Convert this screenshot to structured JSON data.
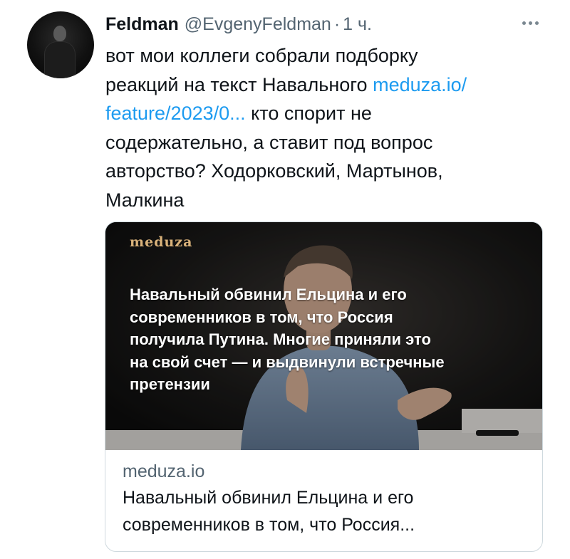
{
  "tweet": {
    "display_name": "Feldman",
    "handle": "@EvgenyFeldman",
    "separator": "·",
    "time": "1 ч.",
    "more_icon": "more-horizontal-icon",
    "text": {
      "line1": "вот мои коллеги собрали подборку",
      "line2_text": "реакций на текст Навального ",
      "line2_link": "meduza.io/",
      "line3_link": "feature/2023/0...",
      "line3_text": " кто спорит не",
      "line4": "содержательно, а ставит под вопрос",
      "line5": "авторство? Ходорковский, Мартынов,",
      "line6": "Малкина"
    }
  },
  "card": {
    "logo": "meduza",
    "headline_lines": [
      "Навальный обвинил Ельцина и его",
      "современников в том, что Россия",
      "получила Путина. Многие приняли это",
      "на свой счет — и выдвинули встречные",
      "претензии"
    ],
    "domain": "meduza.io",
    "title_lines": [
      "Навальный обвинил Ельцина и его",
      "современников в том, что Россия..."
    ]
  },
  "colors": {
    "link": "#1d9bf0",
    "secondary_text": "#536471",
    "logo_gold": "#d9b27a"
  }
}
